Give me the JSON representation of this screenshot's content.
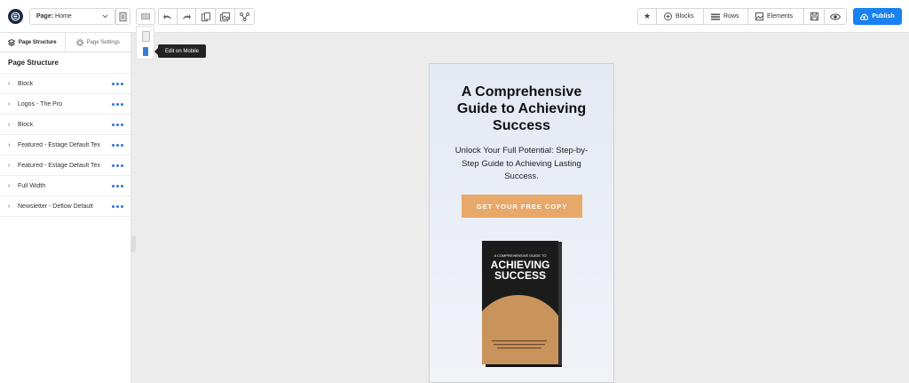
{
  "colors": {
    "accent": "#1a82f0",
    "cta": "#e8a86a",
    "dots": "#2f73e0",
    "logo": "#1a2b4a"
  },
  "toolbar": {
    "page_label_key": "Page:",
    "page_label_value": "Home",
    "blocks": "Blocks",
    "rows": "Rows",
    "elements": "Elements",
    "publish": "Publish"
  },
  "device_tooltip": "Edit on Mobile",
  "sidebar": {
    "tabs": [
      {
        "label": "Page Structure",
        "icon": "layers-icon"
      },
      {
        "label": "Page Settings",
        "icon": "gear-icon"
      }
    ],
    "title": "Page Structure",
    "items": [
      {
        "label": "Block"
      },
      {
        "label": "Logos - The Pro"
      },
      {
        "label": "Block"
      },
      {
        "label": "Featured - Estage Default Tex"
      },
      {
        "label": "Featured - Estage Default Tex"
      },
      {
        "label": "Full Width"
      },
      {
        "label": "Newsletter - Deflow Default"
      }
    ]
  },
  "preview": {
    "title_lines": [
      "A Comprehensive",
      "Guide to Achieving",
      "Success"
    ],
    "subtitle_lines": [
      "Unlock Your Full Potential: Step-by-",
      "Step Guide to Achieving Lasting",
      "Success."
    ],
    "cta": "GET YOUR FREE COPY",
    "book": {
      "kicker": "A COMPREHENSIVE GUIDE TO",
      "title_1": "ACHIEVING",
      "title_2": "SUCCESS"
    }
  }
}
